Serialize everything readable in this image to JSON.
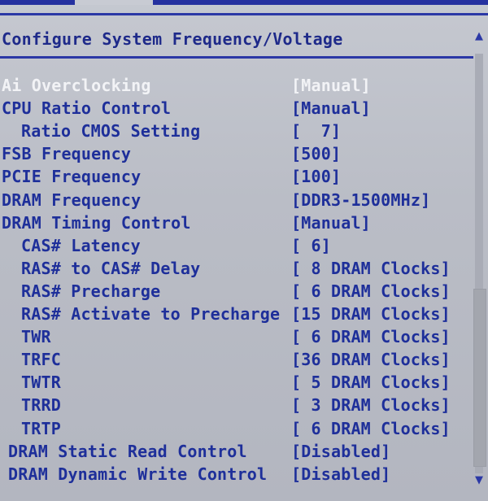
{
  "screen": {
    "title": "Configure System Frequency/Voltage",
    "colors": {
      "background": "#babdc6",
      "text_blue": "#1e2f9a",
      "text_white": "#f2f3f6",
      "rule_blue": "#2b38a6"
    },
    "scroll": {
      "up_icon": "▲",
      "down_icon": "▼",
      "thumb_top_fraction": 0.56,
      "thumb_height_fraction": 0.42
    }
  },
  "settings": [
    {
      "label": "Ai Overclocking",
      "value": "[Manual]",
      "indent": 0,
      "disabled": true
    },
    {
      "label": "CPU Ratio Control",
      "value": "[Manual]",
      "indent": 0,
      "disabled": false
    },
    {
      "label": "Ratio CMOS Setting",
      "value": "[  7]",
      "indent": 1,
      "disabled": false
    },
    {
      "label": "FSB Frequency",
      "value": "[500]",
      "indent": 0,
      "disabled": false
    },
    {
      "label": "PCIE Frequency",
      "value": "[100]",
      "indent": 0,
      "disabled": false
    },
    {
      "label": "DRAM Frequency",
      "value": "[DDR3-1500MHz]",
      "indent": 0,
      "disabled": false
    },
    {
      "label": "DRAM Timing Control",
      "value": "[Manual]",
      "indent": 0,
      "disabled": false
    },
    {
      "label": "CAS# Latency",
      "value": "[ 6]",
      "indent": 1,
      "disabled": false
    },
    {
      "label": "RAS# to CAS# Delay",
      "value": "[ 8 DRAM Clocks]",
      "indent": 1,
      "disabled": false
    },
    {
      "label": "RAS# Precharge",
      "value": "[ 6 DRAM Clocks]",
      "indent": 1,
      "disabled": false
    },
    {
      "label": "RAS# Activate to Precharge",
      "value": "[15 DRAM Clocks]",
      "indent": 1,
      "disabled": false
    },
    {
      "label": "TWR",
      "value": "[ 6 DRAM Clocks]",
      "indent": 1,
      "disabled": false
    },
    {
      "label": "TRFC",
      "value": "[36 DRAM Clocks]",
      "indent": 1,
      "disabled": false
    },
    {
      "label": "TWTR",
      "value": "[ 5 DRAM Clocks]",
      "indent": 1,
      "disabled": false
    },
    {
      "label": "TRRD",
      "value": "[ 3 DRAM Clocks]",
      "indent": 1,
      "disabled": false
    },
    {
      "label": "TRTP",
      "value": "[ 6 DRAM Clocks]",
      "indent": 1,
      "disabled": false
    },
    {
      "label": "DRAM Static Read Control",
      "value": "[Disabled]",
      "indent": 2,
      "disabled": false
    },
    {
      "label": "DRAM Dynamic Write Control",
      "value": "[Disabled]",
      "indent": 2,
      "disabled": false
    }
  ]
}
